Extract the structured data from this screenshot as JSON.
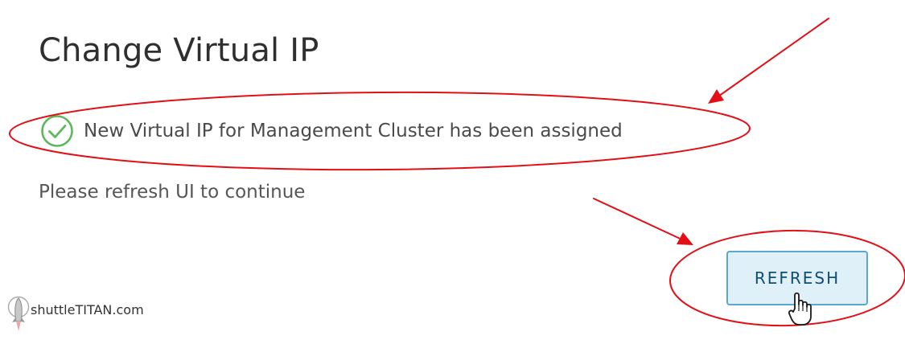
{
  "dialog": {
    "title": "Change Virtual IP",
    "success_message": "New Virtual IP for Management Cluster has been assigned",
    "info_message": "Please refresh UI to continue",
    "refresh_label": "REFRESH"
  },
  "icons": {
    "success": "check-circle-icon",
    "cursor": "hand-pointer-icon",
    "watermark_logo": "rocket-icon"
  },
  "watermark": {
    "text": "shuttleTITAN.com"
  },
  "colors": {
    "success_icon": "#5cb85c",
    "annotation": "#e30f16",
    "button_background": "#dff0f8",
    "button_border": "#5aa7cf",
    "button_text": "#0f4f74"
  }
}
